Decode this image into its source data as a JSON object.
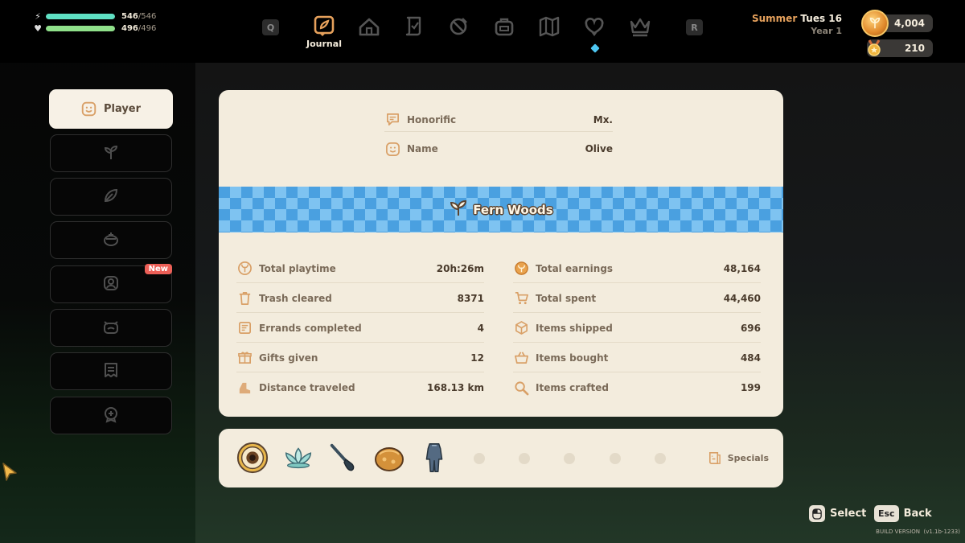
{
  "player_stats": {
    "energy_current": "546",
    "energy_max": "/546",
    "health_current": "496",
    "health_max": "/496",
    "energy_fraction": 1.0,
    "health_fraction": 1.0
  },
  "nav": {
    "key_left": "Q",
    "key_right": "R",
    "active_label": "Journal",
    "icons": [
      "journal-icon",
      "house-icon",
      "quest-scroll-icon",
      "tools-icon",
      "backpack-icon",
      "map-icon",
      "heart-icon",
      "crown-icon"
    ]
  },
  "date": {
    "season": "Summer",
    "day": "Tues 16",
    "year": "Year 1"
  },
  "currency": {
    "coins": "4,004",
    "medals": "210"
  },
  "sidebar": {
    "active_label": "Player",
    "new_badge": "New",
    "tabs": [
      "player-icon",
      "sprout-icon",
      "leaf-icon",
      "pot-icon",
      "villager-icon",
      "critter-icon",
      "recipe-icon",
      "achievement-icon"
    ]
  },
  "identity": {
    "honorific_label": "Honorific",
    "honorific_value": "Mx.",
    "name_label": "Name",
    "name_value": "Olive"
  },
  "farm": {
    "name": "Fern Woods"
  },
  "stats_left": [
    {
      "label": "Total playtime",
      "value": "20h:26m"
    },
    {
      "label": "Trash cleared",
      "value": "8371"
    },
    {
      "label": "Errands completed",
      "value": "4"
    },
    {
      "label": "Gifts given",
      "value": "12"
    },
    {
      "label": "Distance traveled",
      "value": "168.13 km"
    }
  ],
  "stats_right": [
    {
      "label": "Total earnings",
      "value": "48,164"
    },
    {
      "label": "Total spent",
      "value": "44,460"
    },
    {
      "label": "Items shipped",
      "value": "696"
    },
    {
      "label": "Items bought",
      "value": "484"
    },
    {
      "label": "Items crafted",
      "value": "199"
    }
  ],
  "specials": {
    "label": "Specials",
    "items": [
      "eye-orb-icon",
      "lotus-icon",
      "paintbrush-icon",
      "golden-pot-icon",
      "diving-suit-icon"
    ]
  },
  "controls": {
    "select_label": "Select",
    "back_key": "Esc",
    "back_label": "Back"
  },
  "build": {
    "label": "BUILD VERSION",
    "version": "(v1.1b-1233)"
  },
  "colors": {
    "energy_bar": "#5fe0c3",
    "health_bar": "#8fe08a",
    "card_bg": "#f3ecdd",
    "banner_blue": "#4aa0e0",
    "accent_orange": "#e6a15c",
    "new_badge": "#ec5f57"
  }
}
